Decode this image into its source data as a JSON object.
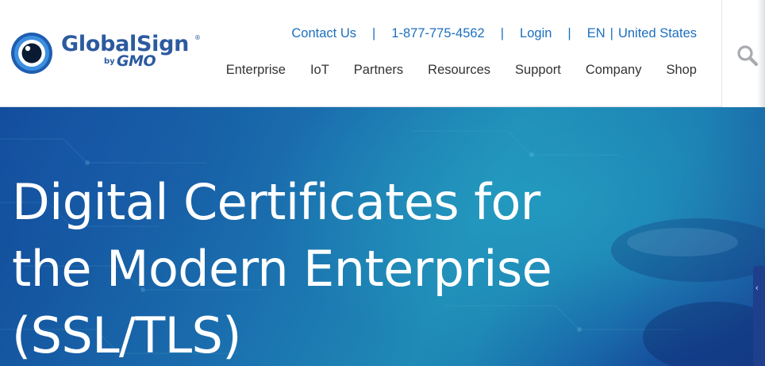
{
  "brand": {
    "name": "GlobalSign",
    "registered_mark": "®",
    "by": "by",
    "parent": "GMO",
    "colors": {
      "primary": "#2c5aa0",
      "link": "#1c6fbf",
      "logo_dark": "#0a1a33",
      "logo_ring": "#1f5db0"
    }
  },
  "utility_nav": {
    "contact_label": "Contact Us",
    "separator": "|",
    "phone": "1-877-775-4562",
    "login_label": "Login",
    "language": "EN",
    "region": "United States"
  },
  "main_nav": {
    "items": [
      {
        "label": "Enterprise"
      },
      {
        "label": "IoT"
      },
      {
        "label": "Partners"
      },
      {
        "label": "Resources"
      },
      {
        "label": "Support"
      },
      {
        "label": "Company"
      },
      {
        "label": "Shop"
      }
    ]
  },
  "search": {
    "icon": "search-icon"
  },
  "hero": {
    "title": "Digital Certificates for\nthe Modern Enterprise\n(SSL/TLS)",
    "side_tab_icon": "chevron-icon",
    "colors": {
      "deep_blue": "#124a9a",
      "teal": "#1f8ab6",
      "text": "#ffffff"
    }
  }
}
